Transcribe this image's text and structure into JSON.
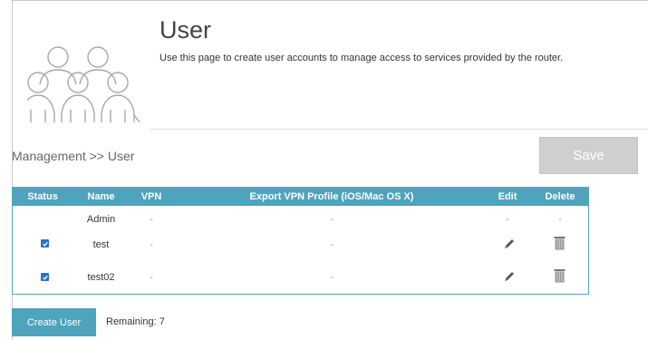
{
  "page": {
    "title": "User",
    "description": "Use this page to create user accounts to manage access to services provided by the router."
  },
  "breadcrumb": "Management >> User",
  "toolbar": {
    "save_label": "Save"
  },
  "table": {
    "headers": {
      "status": "Status",
      "name": "Name",
      "vpn": "VPN",
      "export": "Export VPN Profile (iOS/Mac OS X)",
      "edit": "Edit",
      "delete": "Delete"
    },
    "rows": [
      {
        "status_checked": null,
        "name": "Admin",
        "vpn": "-",
        "export": "-",
        "edit": "-",
        "delete": "-"
      },
      {
        "status_checked": true,
        "name": "test",
        "vpn": "-",
        "export": "-",
        "edit_icon": "pencil-icon",
        "delete_icon": "trash-icon"
      },
      {
        "status_checked": true,
        "name": "test02",
        "vpn": "-",
        "export": "-",
        "edit_icon": "pencil-icon",
        "delete_icon": "trash-icon"
      }
    ]
  },
  "footer": {
    "create_label": "Create User",
    "remaining": "Remaining: 7"
  },
  "colors": {
    "accent": "#4ea3bd",
    "checkbox": "#2a73c9",
    "save_disabled": "#cfcfcf"
  }
}
